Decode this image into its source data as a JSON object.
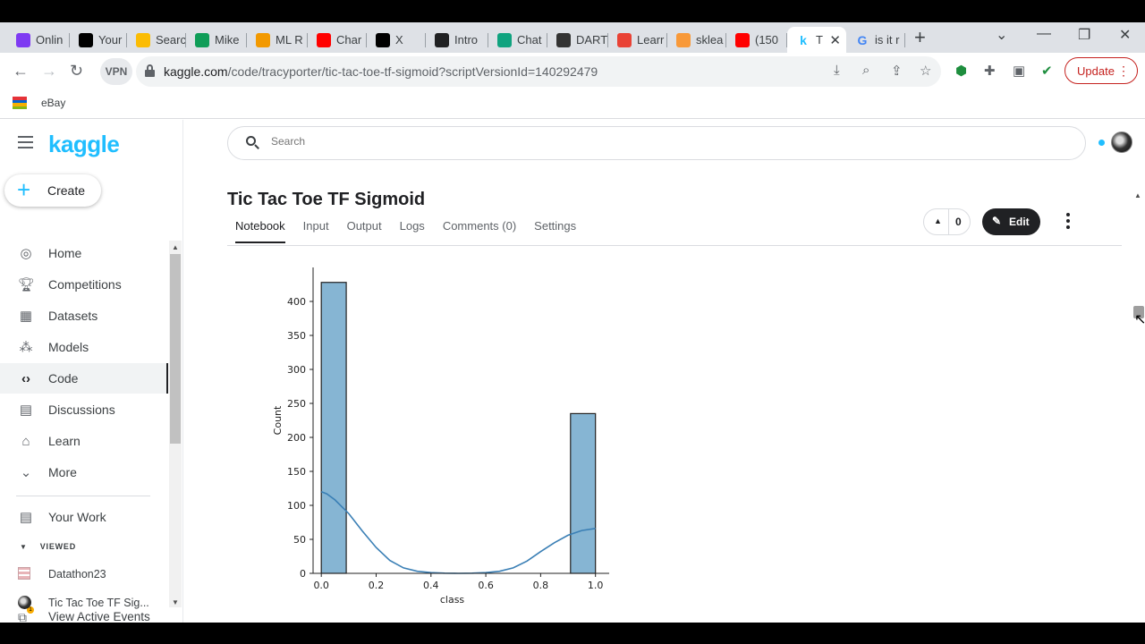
{
  "browser": {
    "tabs": [
      {
        "label": "Onlin",
        "icon": "purple-circle-icon",
        "color": "#7e3af2"
      },
      {
        "label": "Your",
        "icon": "medium-icon",
        "color": "#000000"
      },
      {
        "label": "Searc",
        "icon": "google-drive-icon",
        "color": "#fbbc04"
      },
      {
        "label": "Mike",
        "icon": "google-sheets-plus-icon",
        "color": "#0f9d58"
      },
      {
        "label": "ML R",
        "icon": "coursera-icon",
        "color": "#f29900"
      },
      {
        "label": "Char",
        "icon": "youtube-icon",
        "color": "#ff0000"
      },
      {
        "label": "X",
        "icon": "x-icon",
        "color": "#000000"
      },
      {
        "label": "Intro",
        "icon": "openai-icon",
        "color": "#202123"
      },
      {
        "label": "Chat",
        "icon": "chatgpt-icon",
        "color": "#10a37f"
      },
      {
        "label": "DART",
        "icon": "dart-icon",
        "color": "#333333"
      },
      {
        "label": "Learr",
        "icon": "learn-icon",
        "color": "#e94235"
      },
      {
        "label": "sklea",
        "icon": "sklearn-icon",
        "color": "#f89939"
      },
      {
        "label": "(150",
        "icon": "youtube-icon",
        "color": "#ff0000"
      },
      {
        "label": "T",
        "icon": "kaggle-k-icon",
        "color": "#20beff",
        "active": true
      },
      {
        "label": "is it r",
        "icon": "google-icon",
        "color": "#4285f4"
      }
    ],
    "url_host": "kaggle.com",
    "url_path": "/code/tracyporter/tic-tac-toe-tf-sigmoid?scriptVersionId=140292479",
    "vpn_label": "VPN",
    "update_label": "Update",
    "bookmark": "eBay"
  },
  "sidebar": {
    "logo": "kaggle",
    "create_label": "Create",
    "items": [
      {
        "label": "Home",
        "icon": "compass-icon"
      },
      {
        "label": "Competitions",
        "icon": "trophy-icon"
      },
      {
        "label": "Datasets",
        "icon": "table-icon"
      },
      {
        "label": "Models",
        "icon": "models-icon"
      },
      {
        "label": "Code",
        "icon": "code-icon",
        "active": true
      },
      {
        "label": "Discussions",
        "icon": "discussion-icon"
      },
      {
        "label": "Learn",
        "icon": "graduation-cap-icon"
      },
      {
        "label": "More",
        "icon": "chevron-down-icon"
      }
    ],
    "your_work": "Your Work",
    "viewed_label": "VIEWED",
    "recent": [
      {
        "label": "Datathon23",
        "icon": "grid-thumbnail-icon"
      },
      {
        "label": "Tic Tac Toe TF Sig...",
        "icon": "avatar-icon"
      }
    ],
    "active_events": "View Active Events",
    "events_badge": "1"
  },
  "main": {
    "search_placeholder": "Search",
    "title": "Tic Tac Toe TF Sigmoid",
    "tabs": [
      "Notebook",
      "Input",
      "Output",
      "Logs",
      "Comments (0)",
      "Settings"
    ],
    "active_tab": "Notebook",
    "votes": "0",
    "edit_label": "Edit"
  },
  "chart_data": {
    "type": "bar",
    "subtype": "histogram with KDE",
    "xlabel": "class",
    "ylabel": "Count",
    "xlim": [
      -0.03,
      1.05
    ],
    "ylim": [
      0,
      450
    ],
    "xticks": [
      "0.0",
      "0.2",
      "0.4",
      "0.6",
      "0.8",
      "1.0"
    ],
    "yticks": [
      "0",
      "50",
      "100",
      "150",
      "200",
      "250",
      "300",
      "350",
      "400"
    ],
    "bins": [
      {
        "start": 0.0,
        "end": 0.091,
        "count": 428
      },
      {
        "start": 0.909,
        "end": 1.0,
        "count": 235
      }
    ],
    "kde": {
      "x": [
        0.0,
        0.02,
        0.05,
        0.1,
        0.15,
        0.2,
        0.25,
        0.3,
        0.35,
        0.4,
        0.45,
        0.5,
        0.55,
        0.6,
        0.65,
        0.7,
        0.75,
        0.8,
        0.85,
        0.9,
        0.95,
        1.0
      ],
      "y": [
        120,
        117,
        108,
        88,
        62,
        38,
        19,
        8,
        3,
        1,
        0.3,
        0,
        0.3,
        1,
        3,
        8,
        18,
        32,
        45,
        56,
        63,
        66
      ]
    },
    "bar_color": "#86b5d3",
    "line_color": "#3a7fb5",
    "grid": false
  }
}
